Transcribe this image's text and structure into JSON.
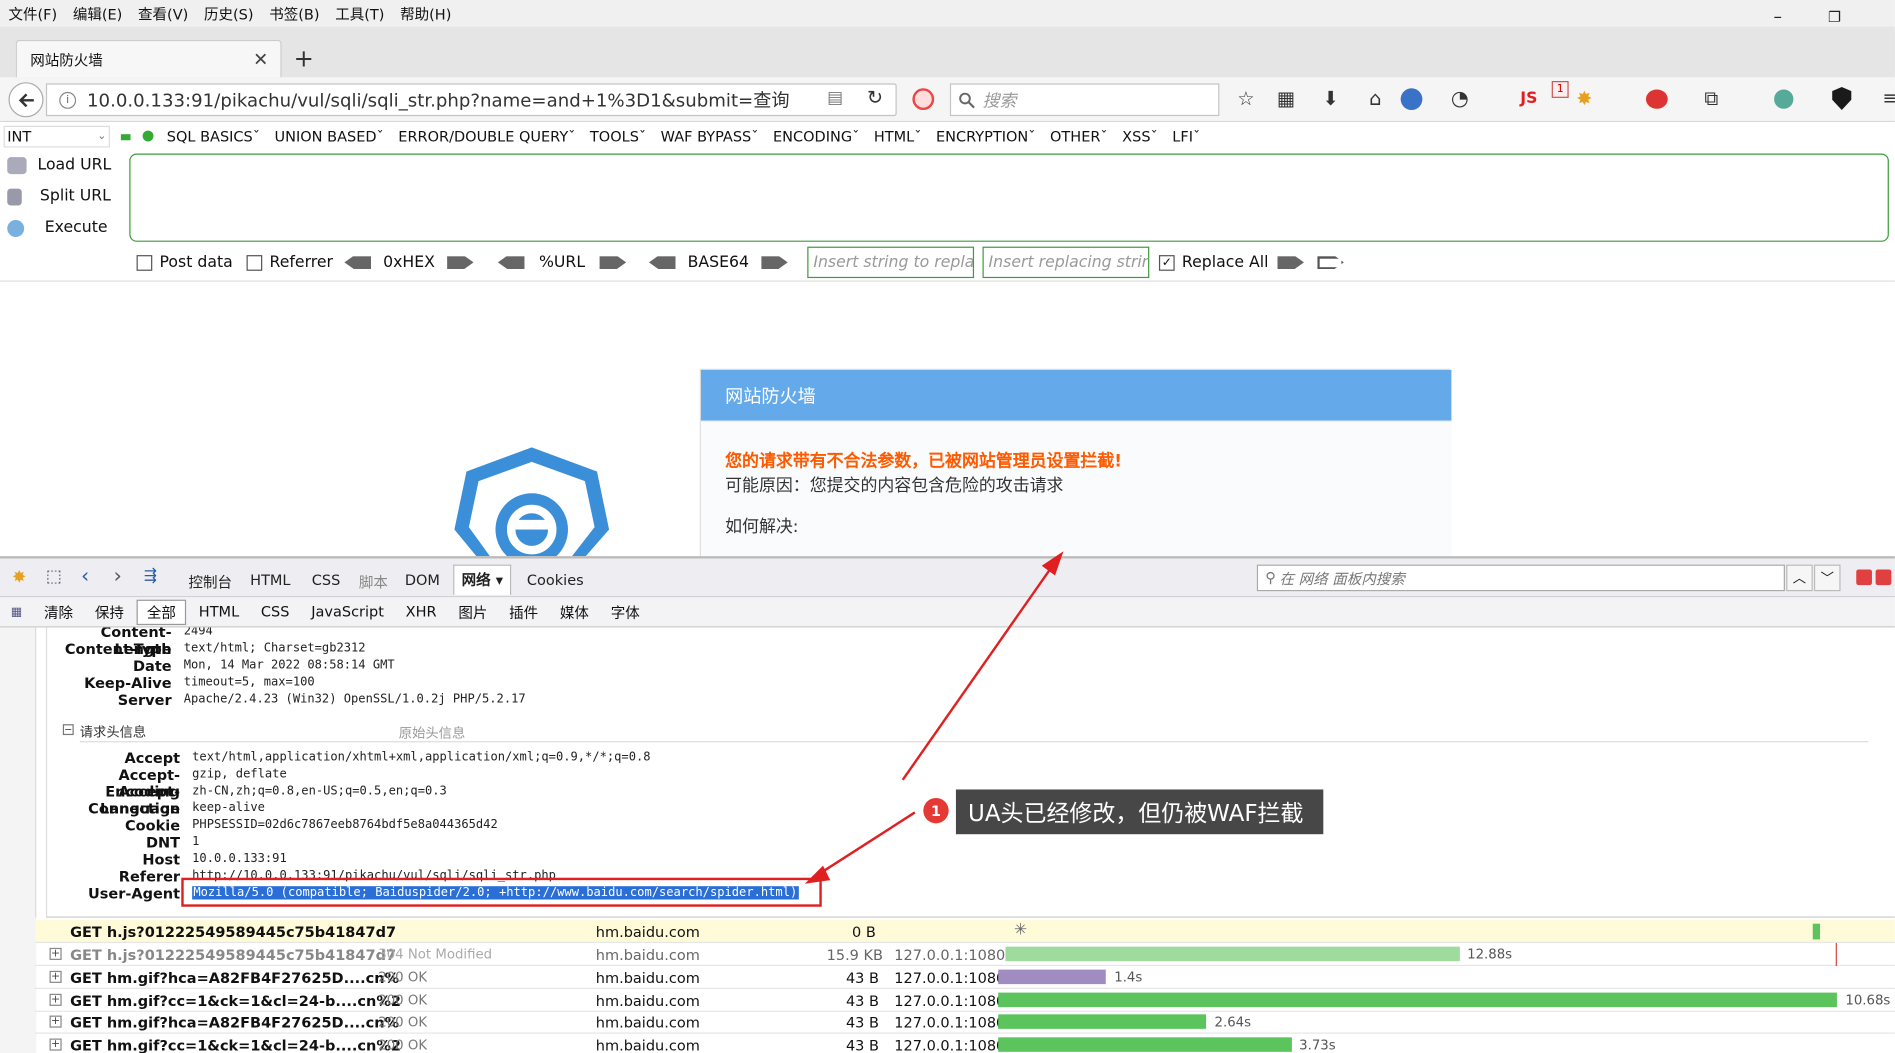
{
  "menubar": {
    "items": [
      "文件(F)",
      "编辑(E)",
      "查看(V)",
      "历史(S)",
      "书签(B)",
      "工具(T)",
      "帮助(H)"
    ],
    "minimize": "–",
    "restore": "❐",
    "close": "✕"
  },
  "tab": {
    "title": "网站防火墙",
    "close": "✕",
    "new": "+"
  },
  "navbar": {
    "url": "10.0.0.133:91/pikachu/vul/sqli/sqli_str.php?name=and+1%3D1&submit=查询",
    "search_placeholder": "搜索",
    "js_label": "JS",
    "js_badge": "1"
  },
  "hackbar": {
    "type_select": "INT",
    "menu": [
      "SQL BASICS",
      "UNION BASED",
      "ERROR/DOUBLE QUERY",
      "TOOLS",
      "WAF BYPASS",
      "ENCODING",
      "HTML",
      "ENCRYPTION",
      "OTHER",
      "XSS",
      "LFI"
    ],
    "load_url": "Load URL",
    "split_url": "Split URL",
    "execute": "Execute",
    "post_data": "Post data",
    "referrer": "Referrer",
    "hex": "0xHEX",
    "url": "%URL",
    "base64": "BASE64",
    "replace_placeholder": "Insert string to replace",
    "replacing_placeholder": "Insert replacing string",
    "replace_all": "Replace All"
  },
  "waf": {
    "title": "网站防火墙",
    "alert": "您的请求带有不合法参数，已被网站管理员设置拦截!",
    "reason": "可能原因：您提交的内容包含危险的攻击请求",
    "howto": "如何解决:"
  },
  "firebug": {
    "tabs": [
      "控制台",
      "HTML",
      "CSS",
      "脚本",
      "DOM",
      "网络",
      "Cookies"
    ],
    "search_placeholder": "在 网络 面板内搜索",
    "subtabs": [
      "清除",
      "保持",
      "全部",
      "HTML",
      "CSS",
      "JavaScript",
      "XHR",
      "图片",
      "插件",
      "媒体",
      "字体"
    ],
    "response_headers": [
      {
        "name": "Content-Length",
        "value": "2494"
      },
      {
        "name": "Content-Type",
        "value": "text/html; Charset=gb2312"
      },
      {
        "name": "Date",
        "value": "Mon, 14 Mar 2022 08:58:14 GMT"
      },
      {
        "name": "Keep-Alive",
        "value": "timeout=5, max=100"
      },
      {
        "name": "Server",
        "value": "Apache/2.4.23 (Win32) OpenSSL/1.0.2j PHP/5.2.17"
      }
    ],
    "request_section": "请求头信息",
    "raw_link": "原始头信息",
    "request_headers": [
      {
        "name": "Accept",
        "value": "text/html,application/xhtml+xml,application/xml;q=0.9,*/*;q=0.8"
      },
      {
        "name": "Accept-Encoding",
        "value": "gzip, deflate"
      },
      {
        "name": "Accept-Language",
        "value": "zh-CN,zh;q=0.8,en-US;q=0.5,en;q=0.3"
      },
      {
        "name": "Connection",
        "value": "keep-alive"
      },
      {
        "name": "Cookie",
        "value": "PHPSESSID=02d6c7867eeb8764bdf5e8a044365d42"
      },
      {
        "name": "DNT",
        "value": "1"
      },
      {
        "name": "Host",
        "value": "10.0.0.133:91"
      },
      {
        "name": "Referer",
        "value": "http://10.0.0.133:91/pikachu/vul/sqli/sqli_str.php"
      },
      {
        "name": "User-Agent",
        "value": "Mozilla/5.0 (compatible; Baiduspider/2.0; +http://www.baidu.com/search/spider.html)"
      }
    ],
    "requests": [
      {
        "url": "GET h.js?01222549589445c75b41847d7",
        "status": "",
        "domain": "hm.baidu.com",
        "size": "0 B",
        "remote": "",
        "time": ""
      },
      {
        "url": "GET h.js?01222549589445c75b41847d7",
        "status": "304 Not Modified",
        "domain": "hm.baidu.com",
        "size": "15.9 KB",
        "remote": "127.0.0.1:1080",
        "time": "12.88s"
      },
      {
        "url": "GET hm.gif?hca=A82FB4F27625D....cn%",
        "status": "200 OK",
        "domain": "hm.baidu.com",
        "size": "43 B",
        "remote": "127.0.0.1:1080",
        "time": "1.4s"
      },
      {
        "url": "GET hm.gif?cc=1&ck=1&cl=24-b....cn%2",
        "status": "200 OK",
        "domain": "hm.baidu.com",
        "size": "43 B",
        "remote": "127.0.0.1:1080",
        "time": "10.68s"
      },
      {
        "url": "GET hm.gif?hca=A82FB4F27625D....cn%",
        "status": "200 OK",
        "domain": "hm.baidu.com",
        "size": "43 B",
        "remote": "127.0.0.1:1080",
        "time": "2.64s"
      },
      {
        "url": "GET hm.gif?cc=1&ck=1&cl=24-b....cn%2",
        "status": "200 OK",
        "domain": "hm.baidu.com",
        "size": "43 B",
        "remote": "127.0.0.1:1080",
        "time": "3.73s"
      }
    ]
  },
  "annotation": {
    "number": "1",
    "text": "UA头已经修改，但仍被WAF拦截"
  },
  "colors": {
    "waf_header": "#64aaea",
    "alert": "#ff5a00",
    "annotation_red": "#e53935",
    "bar_green": "#5cc45c",
    "bar_purple": "#a08cc0",
    "hackbar_green": "#3c9c3c"
  }
}
